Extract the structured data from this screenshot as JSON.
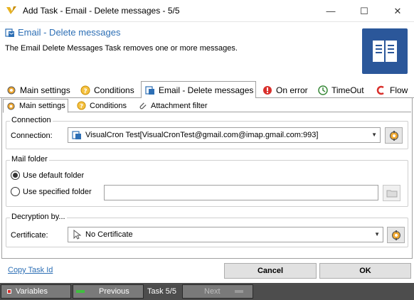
{
  "window": {
    "title": "Add Task - Email - Delete messages - 5/5",
    "minimize_glyph": "—",
    "maximize_glyph": "☐",
    "close_glyph": "✕"
  },
  "header": {
    "title": "Email - Delete messages",
    "description": "The Email Delete Messages Task removes one or more messages."
  },
  "tabs": [
    {
      "label": "Main settings",
      "icon": "gear-icon"
    },
    {
      "label": "Conditions",
      "icon": "question-icon"
    },
    {
      "label": "Email - Delete messages",
      "icon": "email-task-icon",
      "active": true
    },
    {
      "label": "On error",
      "icon": "error-icon"
    },
    {
      "label": "TimeOut",
      "icon": "timeout-icon"
    },
    {
      "label": "Flow",
      "icon": "flow-icon"
    }
  ],
  "subtabs": [
    {
      "label": "Main settings",
      "active": true
    },
    {
      "label": "Conditions"
    },
    {
      "label": "Attachment filter"
    }
  ],
  "connection": {
    "group_title": "Connection",
    "label": "Connection:",
    "value": "VisualCron Test[VisualCronTest@gmail.com@imap.gmail.com:993]"
  },
  "mail_folder": {
    "group_title": "Mail folder",
    "option_default": "Use default folder",
    "option_specified": "Use specified folder",
    "selected": "default",
    "specified_value": ""
  },
  "decryption": {
    "group_title": "Decryption by...",
    "label": "Certificate:",
    "value": "No Certificate"
  },
  "footer": {
    "copy_link": "Copy Task Id",
    "cancel": "Cancel",
    "ok": "OK"
  },
  "statusbar": {
    "variables": "Variables",
    "previous": "Previous",
    "task_counter": "Task 5/5",
    "next": "Next"
  },
  "colors": {
    "accent": "#2d6fb5",
    "statusbar": "#4d4d4d",
    "doc_icon": "#2b579a"
  }
}
